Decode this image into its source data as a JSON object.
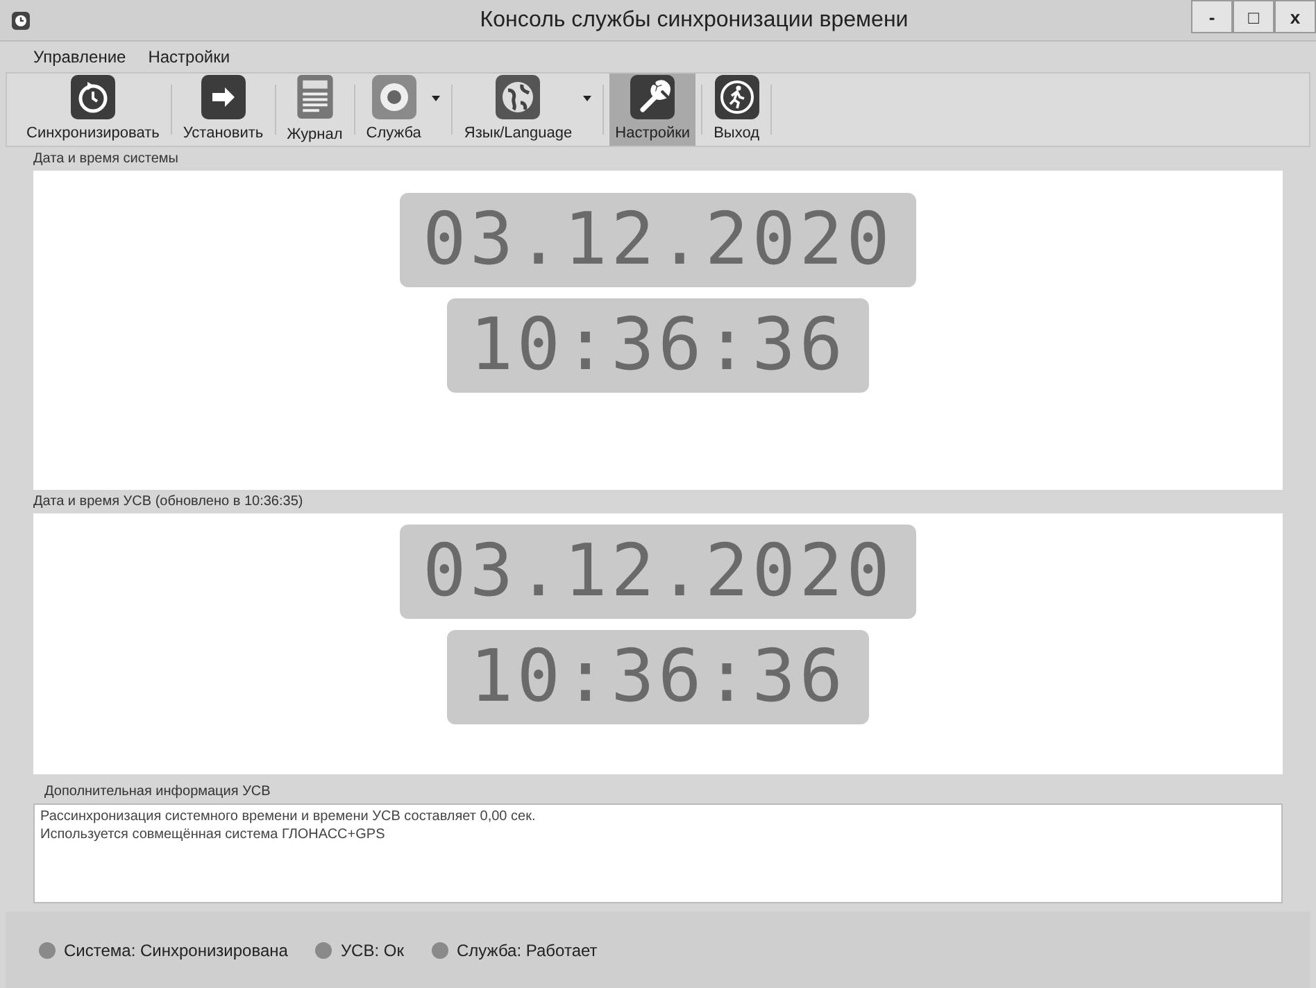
{
  "window": {
    "title": "Консоль службы синхронизации времени"
  },
  "window_controls": [
    "-",
    "□",
    "x"
  ],
  "menu": [
    "Управление",
    "Настройки"
  ],
  "toolbar": [
    {
      "kind": "sync",
      "label": "Синхронизировать",
      "selected": false,
      "dropdown": false
    },
    {
      "kind": "set",
      "label": "Установить",
      "selected": false,
      "dropdown": false
    },
    {
      "kind": "log",
      "label": "Журнал",
      "selected": false,
      "dropdown": false
    },
    {
      "kind": "service",
      "label": "Служба",
      "selected": false,
      "dropdown": true
    },
    {
      "kind": "language",
      "label": "Язык/Language",
      "selected": false,
      "dropdown": true
    },
    {
      "kind": "settings",
      "label": "Настройки",
      "selected": true,
      "dropdown": false
    },
    {
      "kind": "exit",
      "label": "Выход",
      "selected": false,
      "dropdown": false
    }
  ],
  "panels": [
    {
      "header": "Дата и время системы",
      "date": "03.12.2020",
      "time": "10:36:36"
    },
    {
      "header": "Дата и время УСВ (обновлено в 10:36:35)",
      "date": "03.12.2020",
      "time": "10:36:36"
    }
  ],
  "info": {
    "header": "Дополнительная информация УСВ",
    "lines": [
      "Рассинхронизация системного времени и времени УСВ составляет 0,00 сек.",
      "Используется совмещённая система ГЛОНАСС+GPS"
    ]
  },
  "status_bar": [
    "Система: Синхронизирована",
    "УСВ: Ок",
    "Служба: Работает"
  ]
}
